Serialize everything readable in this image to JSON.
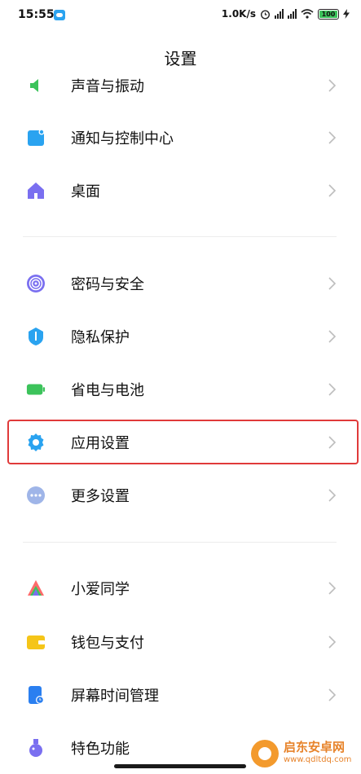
{
  "status_bar": {
    "time": "15:55",
    "net_speed": "1.0K/s",
    "battery": "100"
  },
  "header": {
    "title": "设置"
  },
  "items": [
    {
      "label": "声音与振动",
      "icon": "speaker-icon",
      "color": "#3cc35b"
    },
    {
      "label": "通知与控制中心",
      "icon": "notification-icon",
      "color": "#2aa3f0"
    },
    {
      "label": "桌面",
      "icon": "home-icon",
      "color": "#7a6ff0"
    },
    {
      "label": "密码与安全",
      "icon": "fingerprint-icon",
      "color": "#7a6ff0"
    },
    {
      "label": "隐私保护",
      "icon": "shield-icon",
      "color": "#2aa3f0"
    },
    {
      "label": "省电与电池",
      "icon": "battery-icon",
      "color": "#3cc35b"
    },
    {
      "label": "应用设置",
      "icon": "gear-icon",
      "color": "#2aa3f0"
    },
    {
      "label": "更多设置",
      "icon": "more-icon",
      "color": "#9fb5e8"
    },
    {
      "label": "小爱同学",
      "icon": "xiaoai-icon",
      "color": "#ff6b6b"
    },
    {
      "label": "钱包与支付",
      "icon": "wallet-icon",
      "color": "#f5c518"
    },
    {
      "label": "屏幕时间管理",
      "icon": "screen-time-icon",
      "color": "#2a7ff0"
    },
    {
      "label": "特色功能",
      "icon": "flask-icon",
      "color": "#7a6ff0"
    }
  ],
  "highlight": {
    "target": "应用设置",
    "color": "#e03a3a"
  },
  "watermark": {
    "title": "启东安卓网",
    "url": "www.qdltdq.com"
  }
}
